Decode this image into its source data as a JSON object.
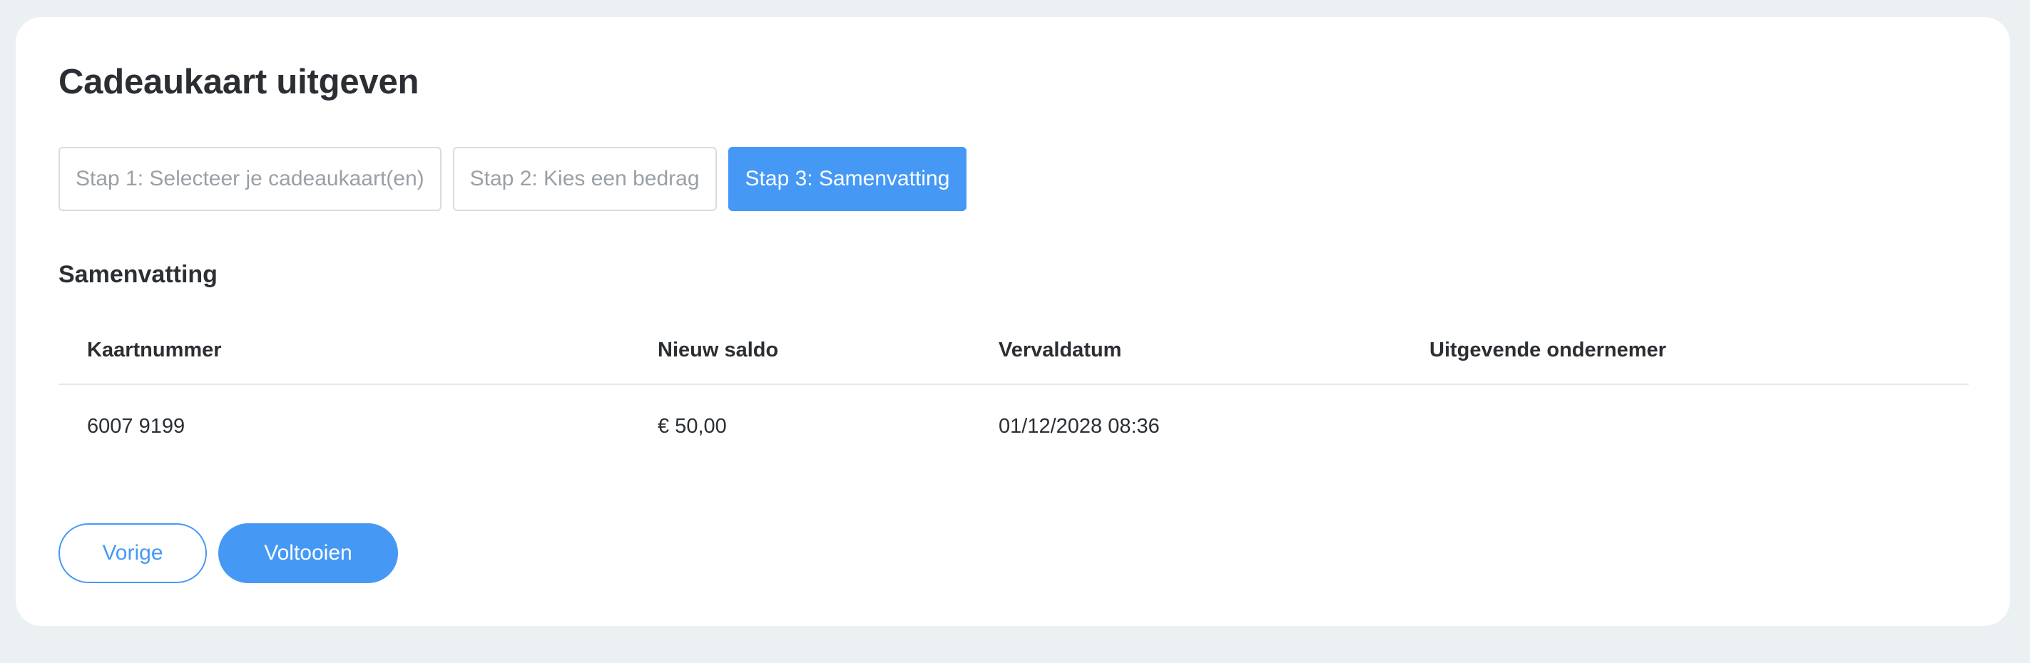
{
  "page": {
    "title": "Cadeaukaart uitgeven"
  },
  "steps": [
    {
      "label": "Stap 1: Selecteer je cadeaukaart(en)",
      "state": "inactive"
    },
    {
      "label": "Stap 2: Kies een bedrag",
      "state": "inactive"
    },
    {
      "label": "Stap 3: Samenvatting",
      "state": "active"
    }
  ],
  "summary": {
    "title": "Samenvatting",
    "columns": [
      "Kaartnummer",
      "Nieuw saldo",
      "Vervaldatum",
      "Uitgevende ondernemer"
    ],
    "rows": [
      [
        "6007 9199",
        "€ 50,00",
        "01/12/2028 08:36",
        ""
      ]
    ]
  },
  "actions": {
    "previous_label": "Vorige",
    "finish_label": "Voltooien"
  },
  "colors": {
    "accent": "#4599f5",
    "background": "#ebf0f3",
    "card": "#ffffff",
    "text": "#2b2f33",
    "muted": "#9aa0a6"
  }
}
